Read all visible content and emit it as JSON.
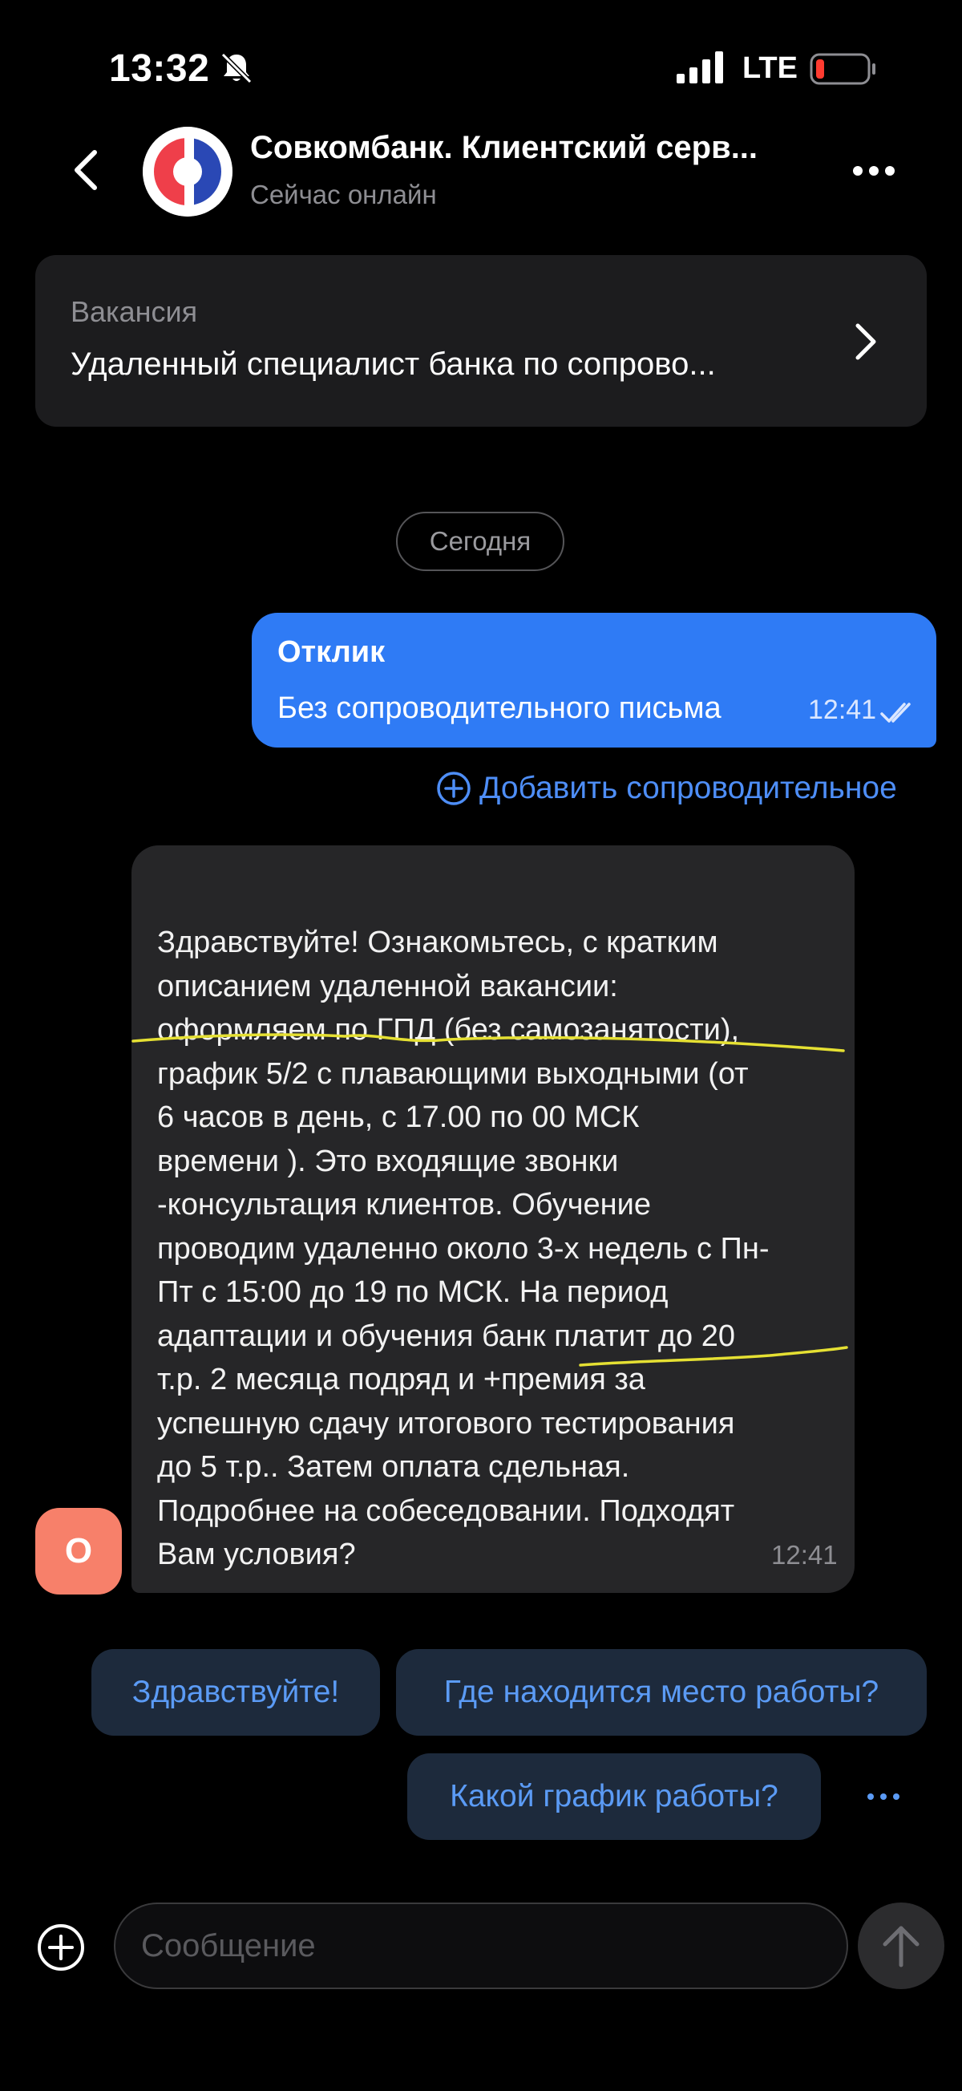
{
  "status_bar": {
    "time": "13:32",
    "network": "LTE",
    "icons": [
      "bell-slash-icon",
      "signal-icon",
      "battery-low-icon"
    ]
  },
  "header": {
    "title": "Совкомбанк. Клиентский серв...",
    "subtitle": "Сейчас онлайн",
    "icons": [
      "back-chevron-icon",
      "sovcombank-logo",
      "more-dots-icon"
    ]
  },
  "vacancy": {
    "label": "Вакансия",
    "title": "Удаленный специалист банка по сопрово..."
  },
  "date_separator": "Сегодня",
  "outgoing_message": {
    "title": "Отклик",
    "text": "Без сопроводительного письма",
    "time": "12:41",
    "status_icon": "double-check-icon"
  },
  "add_cover_letter": "Добавить сопроводительное",
  "incoming_message": {
    "lines": [
      "Здравствуйте! Ознакомьтесь, с кратким",
      "описанием удаленной вакансии:",
      "оформляем по ГПД (без самозанятости),",
      "график 5/2 с плавающими выходными (от",
      "6 часов в день, с 17.00 по 00 МСК",
      "времени ). Это входящие звонки",
      "-консультация клиентов. Обучение",
      "проводим удаленно около 3-х недель с Пн-",
      "Пт с 15:00 до 19 по МСК. На период",
      "адаптации и обучения банк платит до 20",
      "т.р. 2 месяца подряд и +премия за",
      "успешную сдачу итогового тестирования",
      "до 5 т.р.. Затем оплата сдельная.",
      "Подробнее на собеседовании. Подходят",
      "Вам условия?"
    ],
    "time": "12:41",
    "sender_initial": "О",
    "highlight_color": "#e5e033"
  },
  "quick_replies": [
    "Здравствуйте!",
    "Где находится место работы?",
    "Какой график работы?"
  ],
  "input": {
    "placeholder": "Сообщение"
  },
  "colors": {
    "background": "#000000",
    "outgoing_bubble": "#2f7bf5",
    "incoming_bubble": "#262628",
    "accent": "#4e8ef7",
    "chip_background": "#1d2a3c",
    "avatar": "#f7806a"
  }
}
